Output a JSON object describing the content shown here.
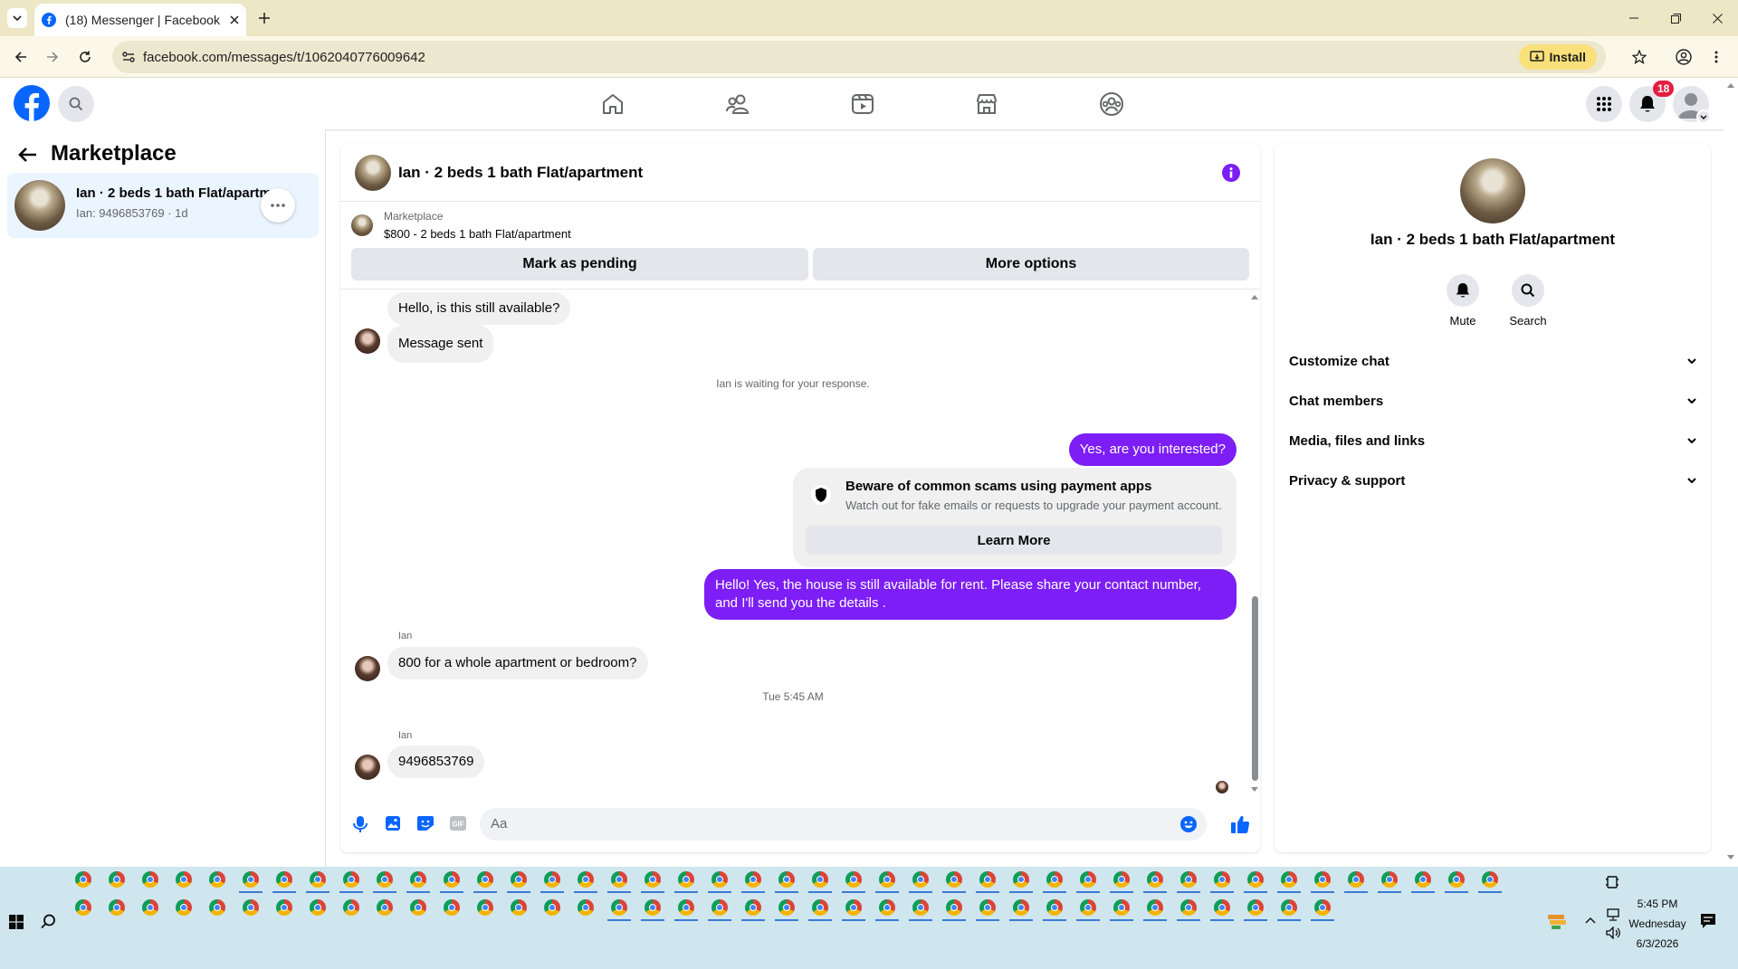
{
  "browser": {
    "tab_title": "(18) Messenger | Facebook",
    "url": "facebook.com/messages/t/1062040776009642",
    "install_label": "Install"
  },
  "header": {
    "notification_count": "18"
  },
  "sidebar": {
    "title": "Marketplace",
    "conversation": {
      "name": "Ian · 2 beds 1 bath Flat/apartment",
      "preview": "Ian: 9496853769 · 1d"
    }
  },
  "chat": {
    "title": "Ian · 2 beds 1 bath Flat/apartment",
    "listing_source": "Marketplace",
    "listing_title": "$800 - 2 beds 1 bath Flat/apartment",
    "mark_pending_label": "Mark as pending",
    "more_options_label": "More options",
    "messages": {
      "m1": "Hello, is this still available?",
      "m2": "Message sent",
      "waiting": "Ian is waiting for your response.",
      "m3": "Yes, are you interested?",
      "scam_title": "Beware of common scams using payment apps",
      "scam_body": "Watch out for fake emails or requests to upgrade your payment account.",
      "learn_more": "Learn More",
      "m4": "Hello! Yes, the house is still available for rent. Please share your contact number, and I'll send you the details .",
      "sender1": "Ian",
      "m5": "800 for a whole apartment or bedroom?",
      "timestamp": "Tue 5:45 AM",
      "sender2": "Ian",
      "m6": "9496853769"
    },
    "composer_placeholder": "Aa"
  },
  "details": {
    "name": "Ian · 2 beds 1 bath Flat/apartment",
    "mute_label": "Mute",
    "search_label": "Search",
    "sections": [
      "Customize chat",
      "Chat members",
      "Media, files and links",
      "Privacy & support"
    ]
  },
  "taskbar": {
    "time": "5:45 PM",
    "day": "Wednesday",
    "date": "6/3/2026"
  },
  "colors": {
    "messenger_accent": "#7c1ef5",
    "facebook_blue": "#0866ff",
    "chrome_tabbar": "#ede7c6"
  }
}
